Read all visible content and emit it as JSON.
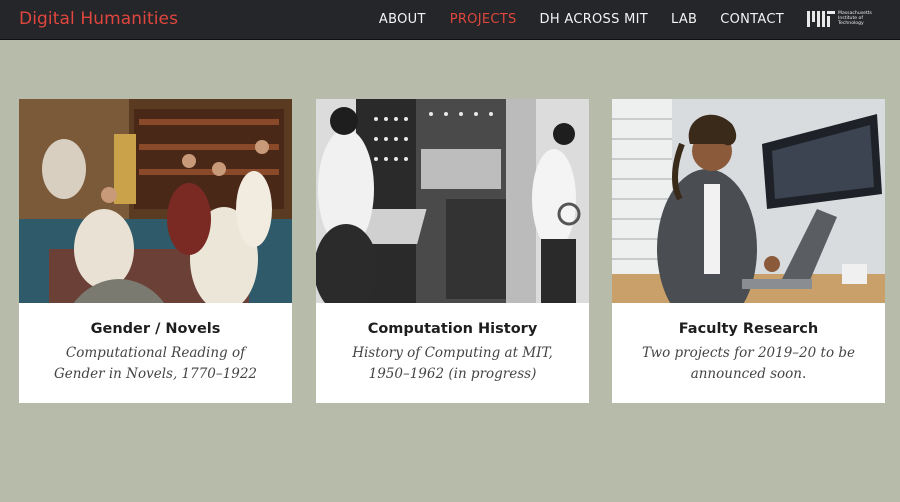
{
  "header": {
    "brand": "Digital Humanities",
    "nav": [
      "ABOUT",
      "PROJECTS",
      "DH ACROSS MIT",
      "LAB",
      "CONTACT"
    ],
    "active_nav": "PROJECTS",
    "logo_text": [
      "Massachusetts",
      "Institute of",
      "Technology"
    ]
  },
  "cards": [
    {
      "title": "Gender / Novels",
      "subtitle": "Computational Reading of Gender in Novels, 1770–1922",
      "image": "painting-women-reading"
    },
    {
      "title": "Computation History",
      "subtitle": "History of Computing at MIT, 1950–1962 (in progress)",
      "image": "vintage-computer-operators"
    },
    {
      "title": "Faculty Research",
      "subtitle": "Two projects for 2019–20 to be announced soon.",
      "image": "researcher-at-laptop"
    }
  ],
  "colors": {
    "accent": "#e0463d",
    "header_bg": "#24262a",
    "page_bg": "#b7bba9"
  }
}
